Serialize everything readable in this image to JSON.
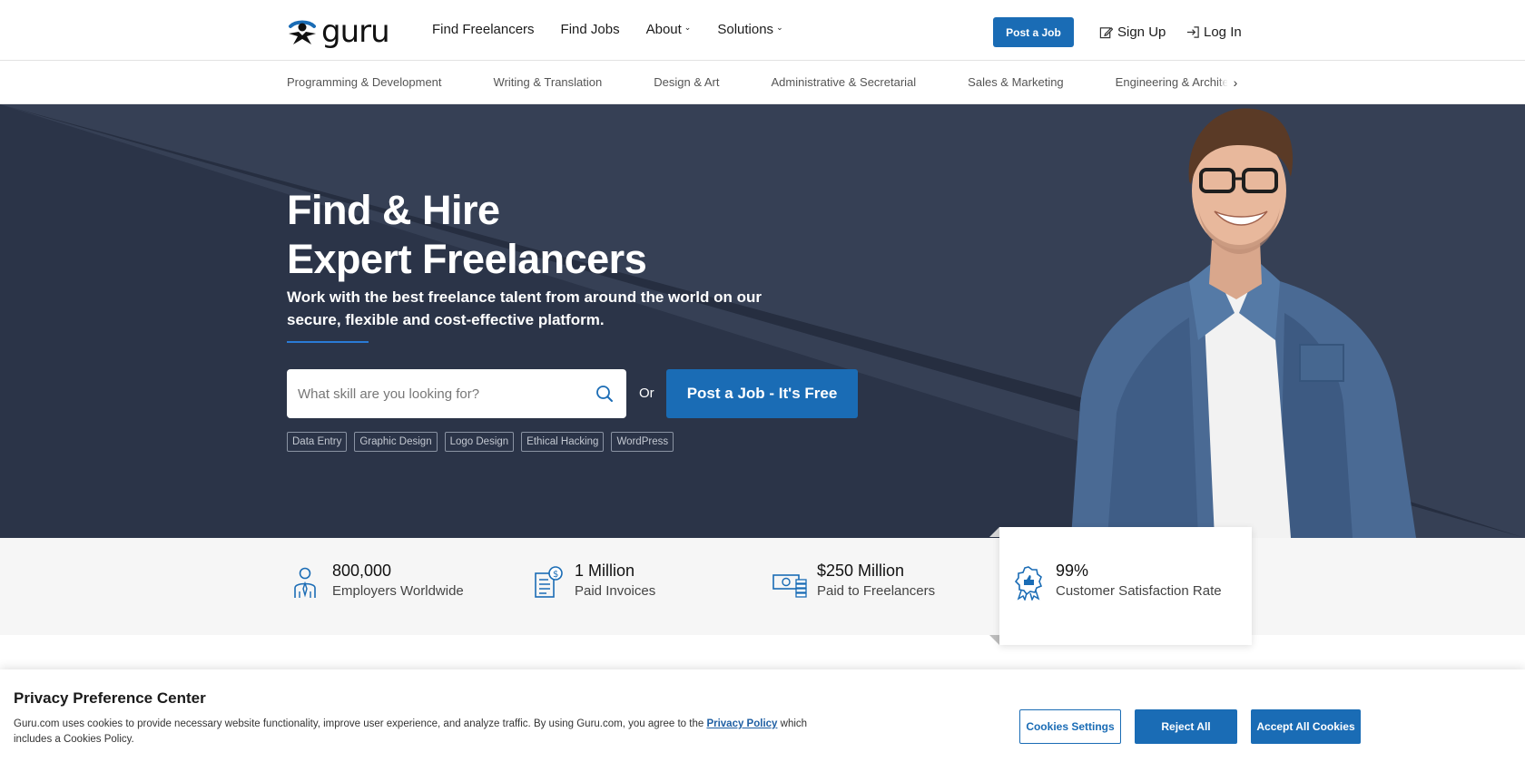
{
  "header": {
    "logo_text": "guru",
    "nav": [
      {
        "label": "Find Freelancers"
      },
      {
        "label": "Find Jobs"
      },
      {
        "label": "About"
      },
      {
        "label": "Solutions"
      }
    ],
    "post_job_label": "Post a Job",
    "sign_up_label": "Sign Up",
    "log_in_label": "Log In"
  },
  "categories": [
    "Programming & Development",
    "Writing & Translation",
    "Design & Art",
    "Administrative & Secretarial",
    "Sales & Marketing",
    "Engineering & Architecture"
  ],
  "hero": {
    "title_line1": "Find & Hire",
    "title_line2": "Expert Freelancers",
    "subtitle": "Work with the best freelance talent from around the world on our secure, flexible and cost-effective platform.",
    "search_placeholder": "What skill are you looking for?",
    "or_label": "Or",
    "cta_label": "Post a Job - It's Free",
    "tags": [
      "Data Entry",
      "Graphic Design",
      "Logo Design",
      "Ethical Hacking",
      "WordPress"
    ]
  },
  "stats": [
    {
      "value": "800,000",
      "label": "Employers Worldwide",
      "icon": "employer-icon"
    },
    {
      "value": "1 Million",
      "label": "Paid Invoices",
      "icon": "invoice-icon"
    },
    {
      "value": "$250 Million",
      "label": "Paid to Freelancers",
      "icon": "money-icon"
    },
    {
      "value": "99%",
      "label": "Customer Satisfaction Rate",
      "icon": "award-icon"
    }
  ],
  "cookie": {
    "title": "Privacy Preference Center",
    "text_before": "Guru.com uses cookies to provide necessary website functionality, improve user experience, and analyze traffic. By using Guru.com, you agree to the ",
    "link": "Privacy Policy",
    "text_after": " which includes a Cookies Policy.",
    "settings_label": "Cookies Settings",
    "reject_label": "Reject All",
    "accept_label": "Accept All Cookies"
  },
  "colors": {
    "brand_blue": "#1a6cb5",
    "hero_bg": "#2b3448"
  }
}
